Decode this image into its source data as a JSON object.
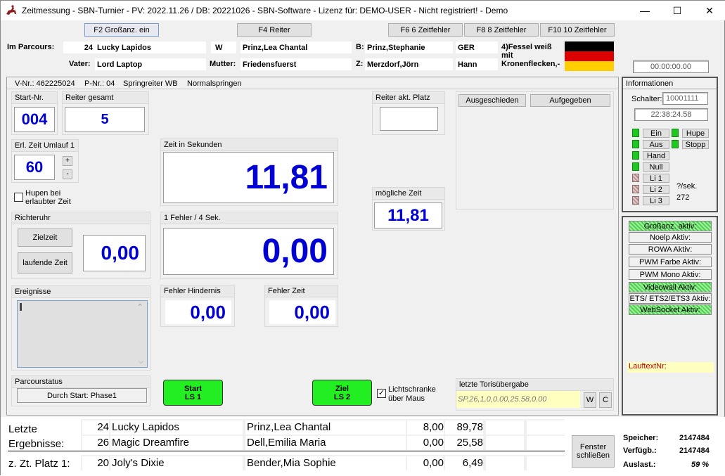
{
  "window": {
    "title": "Zeitmessung - SBN-Turnier - PV: 2022.11.26 / DB: 20221026 - SBN-Software - Lizenz für: DEMO-USER - Nicht registriert! - Demo",
    "minimize": "—",
    "maximize": "☐",
    "close": "✕"
  },
  "toolbar": {
    "f2": "F2 Großanz. ein",
    "f4": "F4 Reiter",
    "f6": "F6 6 Zeitfehler",
    "f8": "F8 8 Zeitfehler",
    "f10": "F10 10 Zeitfehler"
  },
  "header": {
    "im_parcours_label": "Im Parcours:",
    "number": "24",
    "horse": "Lucky Lapidos",
    "sex": "W",
    "rider": "Prinz,Lea Chantal",
    "b_label": "B:",
    "owner": "Prinz,Stephanie",
    "nation": "GER",
    "note": "4)Fessel weiß mit Kronenflecken,-",
    "vater_label": "Vater:",
    "vater": "Lord Laptop",
    "mutter_label": "Mutter:",
    "mutter": "Friedensfuerst",
    "z_label": "Z:",
    "breeder": "Merzdorf,Jörn",
    "breed": "Hann",
    "clock": "00:00:00.00"
  },
  "info_line": {
    "vnr": "V-Nr.: 462225024",
    "pnr": "P-Nr.: 04",
    "class": "Springreiter WB",
    "mode": "Normalspringen"
  },
  "start_nr": {
    "label": "Start-Nr.",
    "value": "004"
  },
  "reiter_gesamt": {
    "label": "Reiter gesamt",
    "value": "5"
  },
  "erl_zeit": {
    "label": "Erl. Zeit Umlauf 1",
    "value": "60",
    "plus": "+",
    "minus": "-"
  },
  "hupen": {
    "label": "Hupen bei erlaubter Zeit"
  },
  "richteruhr": {
    "label": "Richteruhr",
    "zielzeit": "Zielzeit",
    "laufende": "laufende Zeit",
    "value": "0,00"
  },
  "zeit_sekunden": {
    "label": "Zeit in Sekunden",
    "value": "11,81"
  },
  "fehler_sek": {
    "label": "1 Fehler / 4 Sek.",
    "value": "0,00"
  },
  "reiter_akt": {
    "label": "Reiter akt. Platz",
    "value": ""
  },
  "moegliche_zeit": {
    "label": "mögliche Zeit",
    "value": "11,81"
  },
  "ausgeschieden": "Ausgeschieden",
  "aufgegeben": "Aufgegeben",
  "ereignisse": {
    "label": "Ereignisse"
  },
  "fehler_hindernis": {
    "label": "Fehler Hindernis",
    "value": "0,00"
  },
  "fehler_zeit": {
    "label": "Fehler Zeit",
    "value": "0,00"
  },
  "parcourstatus": {
    "label": "Parcourstatus",
    "value": "Durch Start: Phase1"
  },
  "start_btn": {
    "line1": "Start",
    "line2": "LS 1"
  },
  "ziel_btn": {
    "line1": "Ziel",
    "line2": "LS 2"
  },
  "lichtschranke": {
    "label": "Lichtschranke über Maus"
  },
  "tori": {
    "label": "letzte Torisübergabe",
    "value": "SP,26,1,0,0.00,25.58,0.00",
    "w": "W",
    "c": "C"
  },
  "informationen": {
    "label": "Informationen",
    "schalter_label": "Schalter:",
    "schalter_value": "10001111",
    "time": "22:38:24.58",
    "ein": "Ein",
    "hupe": "Hupe",
    "aus": "Aus",
    "stopp": "Stopp",
    "hand": "Hand",
    "null": "Null",
    "li1": "Li 1",
    "li2": "Li 2",
    "li3": "Li 3",
    "per_sec": "?/sek.",
    "count": "272"
  },
  "aktiv": [
    {
      "label": "Großanz. aktiv:",
      "on": true
    },
    {
      "label": "Noelp Aktiv:",
      "on": false
    },
    {
      "label": "ROWA Aktiv:",
      "on": false
    },
    {
      "label": "PWM Farbe Aktiv:",
      "on": false
    },
    {
      "label": "PWM Mono Aktiv:",
      "on": false
    },
    {
      "label": "Videowall Aktiv:",
      "on": true
    },
    {
      "label": "ETS/ ETS2/ETS3 Aktiv:",
      "on": false
    },
    {
      "label": "WebSocket Aktiv:",
      "on": true
    }
  ],
  "lauftext": "LauftextNr:",
  "results": {
    "letzte_label1": "Letzte",
    "letzte_label2": "Ergebnisse:",
    "platz_label": "z. Zt. Platz 1:",
    "rows": [
      {
        "nr": "24",
        "horse": "Lucky Lapidos",
        "rider": "Prinz,Lea Chantal",
        "f": "8,00",
        "t": "89,78"
      },
      {
        "nr": "26",
        "horse": "Magic Dreamfire",
        "rider": "Dell,Emilia Maria",
        "f": "0,00",
        "t": "25,58"
      }
    ],
    "leader": {
      "nr": "20",
      "horse": "Joly's Dixie",
      "rider": "Bender,Mia Sophie",
      "f": "0,00",
      "t": "6,49"
    }
  },
  "fenster": {
    "line1": "Fenster",
    "line2": "schließen"
  },
  "memory": {
    "speicher_label": "Speicher:",
    "speicher": "2147484",
    "verfueg_label": "Verfügb.:",
    "verfueg": "2147484",
    "auslast_label": "Auslast.:",
    "auslast": "59 %"
  },
  "colors": {
    "accent_blue": "#0000d4",
    "green": "#22ee22",
    "flag": [
      "#000000",
      "#dd0000",
      "#ffce00"
    ]
  }
}
